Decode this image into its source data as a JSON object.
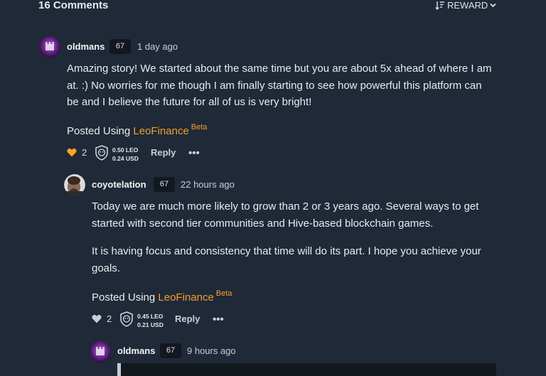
{
  "header": {
    "comments_count": "16 Comments",
    "sort_label": "REWARD"
  },
  "comments": [
    {
      "username": "oldmans",
      "reputation": "67",
      "time": "1 day ago",
      "paragraphs": [
        "Amazing story! We started about the same time but you are about 5x ahead of where I am at. :) No worries for me though I am finally starting to see how powerful this platform can be and I believe the future for all of us is very bright!"
      ],
      "posted_prefix": "Posted Using",
      "posted_link": "LeoFinance",
      "posted_beta": "Beta",
      "votes": "2",
      "payout_leo": "0.50 LEO",
      "payout_usd": "0.24 USD",
      "reply_label": "Reply",
      "more_label": "•••"
    },
    {
      "username": "coyotelation",
      "reputation": "67",
      "time": "22 hours ago",
      "paragraphs": [
        "Today we are much more likely to grow than 2 or 3 years ago. Several ways to get started with second tier communities and Hive-based blockchain games.",
        "It is having focus and consistency that time will do its part. I hope you achieve your goals."
      ],
      "posted_prefix": "Posted Using",
      "posted_link": "LeoFinance",
      "posted_beta": "Beta",
      "votes": "2",
      "payout_leo": "0.45 LEO",
      "payout_usd": "0.21 USD",
      "reply_label": "Reply",
      "more_label": "•••"
    },
    {
      "username": "oldmans",
      "reputation": "67",
      "time": "9 hours ago"
    }
  ],
  "colors": {
    "background": "#202938",
    "accent": "#f0a02a",
    "heart_active": "#f5a623",
    "heart_inactive": "#c9ced4"
  },
  "icons": {
    "sort": "sort-desc-icon",
    "chevron": "chevron-down-icon",
    "heart": "heart-icon",
    "leo": "leo-lion-icon",
    "more": "ellipsis-icon"
  }
}
